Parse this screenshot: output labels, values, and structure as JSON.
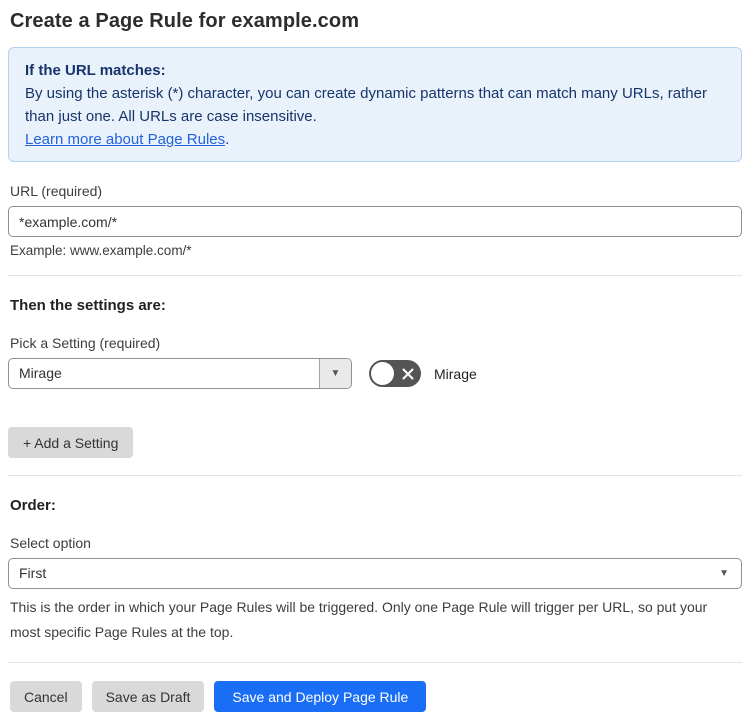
{
  "page": {
    "title": "Create a Page Rule for example.com"
  },
  "info_box": {
    "heading": "If the URL matches:",
    "body": "By using the asterisk (*) character, you can create dynamic patterns that can match many URLs, rather than just one. All URLs are case insensitive.",
    "link": "Learn more about Page Rules",
    "link_suffix": "."
  },
  "url_field": {
    "label": "URL (required)",
    "value": "*example.com/*",
    "help": "Example: www.example.com/*"
  },
  "settings": {
    "heading": "Then the settings are:",
    "picker_label": "Pick a Setting (required)",
    "selected_setting": "Mirage",
    "toggle_state": "off",
    "toggle_label": "Mirage",
    "add_button": "+ Add a Setting"
  },
  "order": {
    "heading": "Order:",
    "select_label": "Select option",
    "selected_option": "First",
    "help": "This is the order in which your Page Rules will be triggered. Only one Page Rule will trigger per URL, so put your most specific Page Rules at the top."
  },
  "footer": {
    "cancel": "Cancel",
    "save_draft": "Save as Draft",
    "save_deploy": "Save and Deploy Page Rule"
  },
  "icons": {
    "chevron_down": "▼"
  },
  "colors": {
    "info_bg": "#e9f1fb",
    "info_border": "#b3d2f2",
    "info_text": "#17356b",
    "link": "#2563d9",
    "primary_button": "#1a6ef5",
    "gray_button": "#d9d9d9",
    "toggle_off": "#545454"
  }
}
